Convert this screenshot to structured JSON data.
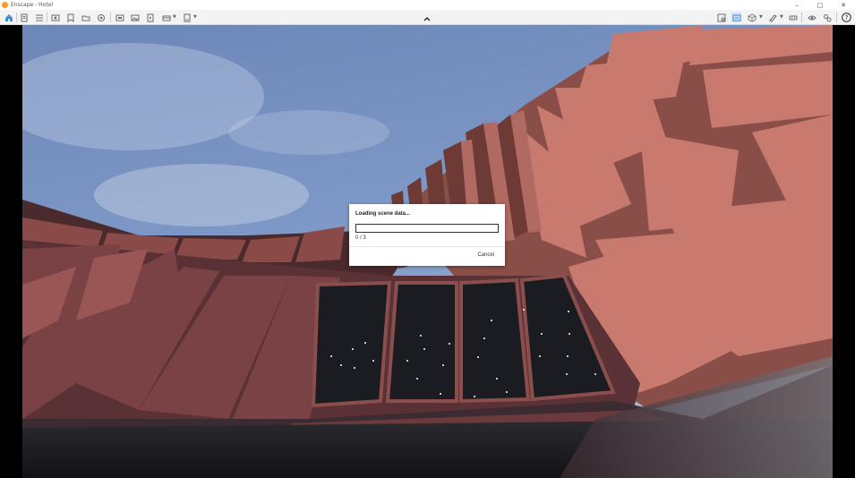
{
  "window": {
    "title": "Enscape - Hotel",
    "minimize_glyph": "–",
    "maximize_glyph": "□",
    "close_glyph": "✕"
  },
  "toolbar": {
    "accent_color": "#3a8fd9",
    "left_icons": [
      "home-icon",
      "document-icon",
      "list-icon",
      "view-icon",
      "save-view-icon",
      "folder-icon",
      "settings-circle-icon",
      "screenshot-icon",
      "image-icon",
      "video-icon",
      "panorama-icon",
      "export-icon"
    ],
    "right_icons": [
      "asset-library-icon",
      "sync-icon",
      "cube-icon",
      "paint-icon",
      "vr-icon",
      "eye-icon",
      "settings-icon",
      "help-icon"
    ],
    "collapse_glyph": "⌃"
  },
  "dialog": {
    "title": "Loading scene data...",
    "progress_text": "0 / 3",
    "progress_fraction": 0,
    "cancel_label": "Cancel"
  }
}
